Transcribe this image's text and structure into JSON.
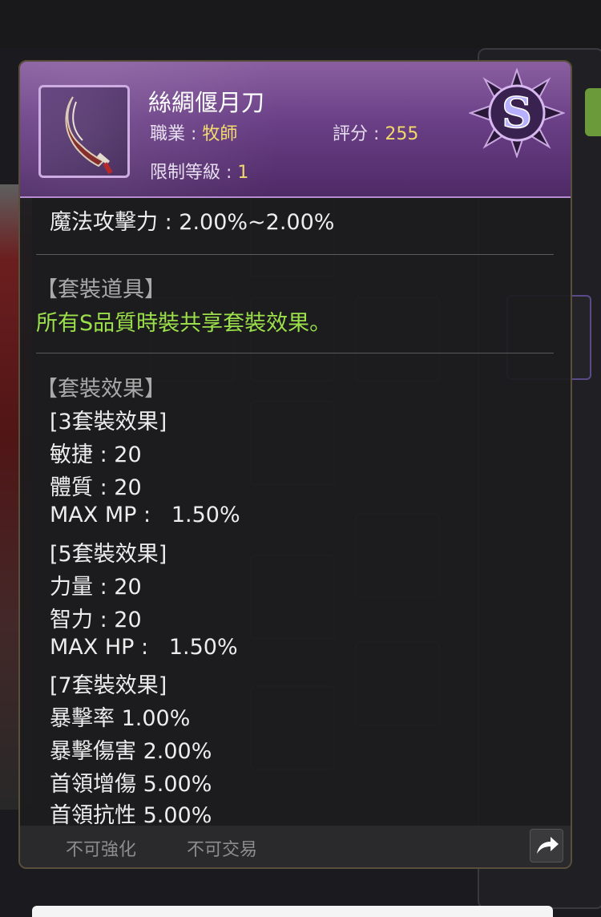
{
  "item": {
    "name": "絲綢偃月刀",
    "job_label": "職業 : ",
    "job_value": "牧師",
    "score_label": "評分 : ",
    "score_value": "255",
    "level_label": "限制等級 : ",
    "level_value": "1",
    "grade": "S",
    "icon": "scimitar-icon"
  },
  "stats": {
    "magic_attack": "魔法攻擊力 : 2.00%~2.00%"
  },
  "set_item": {
    "header": "【套裝道具】",
    "desc": "所有S品質時裝共享套裝效果。"
  },
  "set_effects": {
    "header": "【套裝效果】",
    "tier3_title": "[3套裝效果]",
    "tier3_lines": [
      "敏捷 : 20",
      "體質 : 20",
      "MAX MP :   1.50%"
    ],
    "tier5_title": "[5套裝效果]",
    "tier5_lines": [
      "力量 : 20",
      "智力 : 20",
      "MAX HP :   1.50%"
    ],
    "tier7_title": "[7套裝效果]",
    "tier7_lines": [
      "暴擊率 1.00%",
      "暴擊傷害 2.00%",
      "首領增傷 5.00%",
      "首領抗性 5.00%"
    ]
  },
  "footer": {
    "no_enhance": "不可強化",
    "no_trade": "不可交易",
    "share_icon": "share-arrow-icon"
  },
  "colors": {
    "header_purple": "#6a3f86",
    "value_yellow": "#f2d96a",
    "set_desc_green": "#9be04a"
  }
}
